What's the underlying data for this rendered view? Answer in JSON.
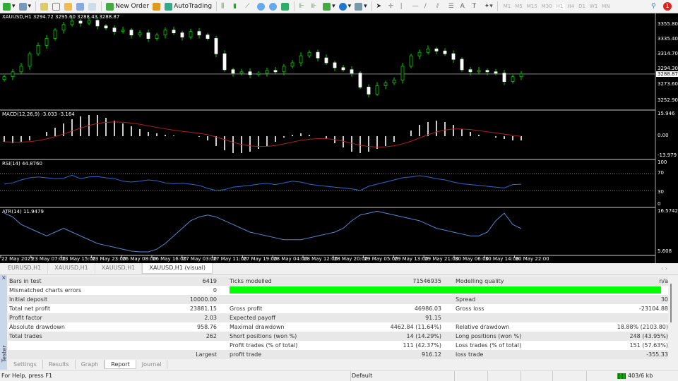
{
  "toolbar": {
    "new_order": "New Order",
    "autotrading": "AutoTrading",
    "timeframes": [
      "M1",
      "M5",
      "M15",
      "M30",
      "H1",
      "H4",
      "D1",
      "W1",
      "MN"
    ],
    "active_timeframe": "H1",
    "notification_count": "1"
  },
  "chart": {
    "header": "XAUUSD,H1  3294.72 3295.60 3288.43 3288.87",
    "current_price": "3288.87",
    "price_ticks": [
      "3355.80",
      "3335.40",
      "3314.70",
      "3294.30",
      "3273.60",
      "3252.90"
    ],
    "macd_label": "MACD(12,26,9) -3.033 -3.164",
    "macd_ticks": [
      "15.946",
      "0.00",
      "-13.979"
    ],
    "rsi_label": "RSI(14) 44.8760",
    "rsi_ticks": [
      "100",
      "70",
      "30",
      "0"
    ],
    "atr_label": "ATR(14) 11.9479",
    "atr_ticks": [
      "16.5742",
      "5.608"
    ],
    "time_labels": [
      "22 May 2025",
      "23 May 07:00",
      "23 May 15:00",
      "23 May 23:00",
      "26 May 08:00",
      "26 May 16:00",
      "27 May 03:00",
      "27 May 11:00",
      "27 May 19:00",
      "28 May 04:00",
      "28 May 12:00",
      "28 May 20:00",
      "29 May 05:00",
      "29 May 13:00",
      "29 May 21:00",
      "30 May 06:00",
      "30 May 14:00",
      "30 May 22:00"
    ]
  },
  "chart_data": {
    "type": "line",
    "title": "XAUUSD,H1",
    "price_range": [
      3240,
      3372
    ],
    "closes": [
      3285,
      3292,
      3300,
      3318,
      3330,
      3340,
      3352,
      3360,
      3365,
      3362,
      3366,
      3358,
      3355,
      3350,
      3352,
      3345,
      3348,
      3340,
      3345,
      3352,
      3348,
      3342,
      3350,
      3345,
      3340,
      3318,
      3295,
      3290,
      3292,
      3288,
      3290,
      3294,
      3292,
      3300,
      3305,
      3315,
      3320,
      3312,
      3305,
      3298,
      3295,
      3290,
      3270,
      3260,
      3272,
      3276,
      3280,
      3300,
      3315,
      3320,
      3325,
      3322,
      3318,
      3310,
      3295,
      3292,
      3294,
      3292,
      3290,
      3278,
      3285,
      3288.87
    ],
    "macd": [
      -4,
      -5,
      -4,
      -3,
      0,
      3,
      6,
      9,
      12,
      14,
      15,
      15,
      13,
      11,
      9,
      7,
      5,
      3,
      2,
      1,
      0.5,
      0,
      0,
      -0.5,
      -3,
      -7,
      -10,
      -12,
      -12,
      -11,
      -9,
      -7,
      -4,
      -1,
      1,
      2,
      1,
      0,
      -2,
      -5,
      -8,
      -11,
      -12,
      -11,
      -9,
      -7,
      -4,
      0,
      4,
      8,
      10,
      11,
      10,
      8,
      5,
      3,
      1,
      0,
      -1,
      -2,
      -3,
      -3.033
    ],
    "rsi": [
      45,
      48,
      55,
      60,
      62,
      60,
      58,
      59,
      66,
      58,
      62,
      63,
      60,
      58,
      52,
      50,
      52,
      55,
      53,
      48,
      46,
      47,
      45,
      42,
      35,
      30,
      32,
      38,
      40,
      42,
      45,
      47,
      44,
      48,
      52,
      50,
      45,
      42,
      40,
      38,
      36,
      34,
      30,
      40,
      45,
      50,
      55,
      60,
      62,
      65,
      62,
      58,
      55,
      50,
      46,
      44,
      42,
      40,
      38,
      36,
      44,
      44.876
    ],
    "atr": [
      16,
      15,
      13,
      12,
      11,
      10,
      11,
      12,
      11,
      10,
      9,
      8,
      7.5,
      7,
      6.5,
      6,
      5.8,
      5.8,
      6.5,
      8,
      10,
      12,
      14,
      15,
      15.5,
      15,
      14,
      13,
      12,
      11,
      10.5,
      10,
      9.5,
      9,
      9,
      9,
      9.5,
      10,
      10.5,
      11,
      12,
      14,
      15.5,
      16,
      16.5,
      16,
      15.5,
      15,
      14.5,
      14,
      13,
      12,
      11.5,
      11,
      10.5,
      10,
      10,
      11,
      14,
      16,
      13,
      11.9479
    ]
  },
  "chart_tabs": [
    "EURUSD,H1",
    "XAUUSD,H1",
    "XAUUSD,H1",
    "XAUUSD,H1 (visual)"
  ],
  "tester": {
    "side_label": "Tester",
    "rows": [
      [
        "Bars in test",
        "6419",
        "Ticks modelled",
        "71546935",
        "Modelling quality",
        "n/a"
      ],
      [
        "Mismatched charts errors",
        "0",
        "",
        "",
        "",
        ""
      ],
      [
        "Initial deposit",
        "10000.00",
        "",
        "",
        "Spread",
        "30"
      ],
      [
        "Total net profit",
        "23881.15",
        "Gross profit",
        "46986.03",
        "Gross loss",
        "-23104.88"
      ],
      [
        "Profit factor",
        "2.03",
        "Expected payoff",
        "91.15",
        "",
        ""
      ],
      [
        "Absolute drawdown",
        "958.76",
        "Maximal drawdown",
        "4462.84 (11.64%)",
        "Relative drawdown",
        "18.88% (2103.80)"
      ],
      [
        "Total trades",
        "262",
        "Short positions (won %)",
        "14 (14.29%)",
        "Long positions (won %)",
        "248 (43.95%)"
      ],
      [
        "",
        "",
        "Profit trades (% of total)",
        "111 (42.37%)",
        "Loss trades (% of total)",
        "151 (57.63%)"
      ],
      [
        "",
        "Largest",
        "profit trade",
        "916.12",
        "loss trade",
        "-355.33"
      ]
    ],
    "tabs": [
      "Settings",
      "Results",
      "Graph",
      "Report",
      "Journal"
    ],
    "active_tab": "Report"
  },
  "status": {
    "help": "For Help, press F1",
    "profile": "Default",
    "traffic": "403/6 kb"
  }
}
